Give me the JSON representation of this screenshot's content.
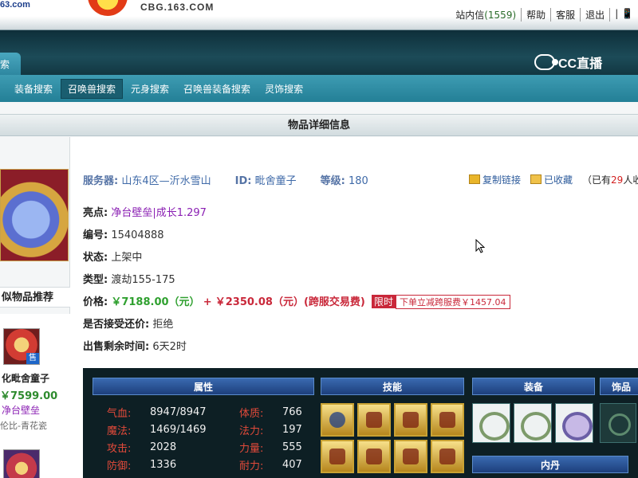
{
  "topbar": {
    "logo_text": "63.com",
    "site_url": "CBG.163.COM",
    "inbox_label": "站内信",
    "inbox_count": "(1559)",
    "help": "帮助",
    "service": "客服",
    "logout": "退出",
    "mobile": "| 📱"
  },
  "navband": {
    "cc_logo": "CC直播",
    "tab_search": "索"
  },
  "subnav": {
    "items": [
      "装备搜索",
      "召唤兽搜索",
      "元身搜索",
      "召唤兽装备搜索",
      "灵饰搜索"
    ],
    "active_index": 1
  },
  "detail_title": "物品详细信息",
  "item": {
    "server_label": "服务器:",
    "server": "山东4区—沂水雪山",
    "id_label": "ID:",
    "id": "毗舍童子",
    "level_label": "等级:",
    "level": "180",
    "copy_link": "复制链接",
    "favorited": "已收藏",
    "fav_count_prefix": "（已有",
    "fav_count": "29",
    "fav_count_suffix": "人收",
    "highlight_label": "亮点:",
    "highlight_value": "净台壁垒|成长1.297",
    "number_label": "编号:",
    "number": "15404888",
    "status_label": "状态:",
    "status": "上架中",
    "type_label": "类型:",
    "type": "渡劫155-175",
    "price_label": "价格:",
    "price_main": "￥7188.00（元）",
    "price_plus": "+",
    "price_fee": "￥2350.08（元）(跨服交易费)",
    "limit_badge": "限时",
    "limit_note": "下单立减跨服费￥1457.04",
    "bargain_label": "是否接受还价:",
    "bargain": "拒绝",
    "remaining_label": "出售剩余时间:",
    "remaining": "6天2时"
  },
  "similar": {
    "heading": "似物品推荐",
    "sold_badge": "售",
    "name": "化毗舍童子",
    "price": "￥7599.00",
    "tag": "净台壁垒",
    "server": "伦比-青花瓷"
  },
  "panel": {
    "attr_header": "属性",
    "skill_header": "技能",
    "equip_header": "装备",
    "accessory_header": "饰品",
    "neidan_header": "内丹",
    "attributes": [
      {
        "k1": "气血:",
        "v1": "8947/8947",
        "k2": "体质:",
        "v2": "766"
      },
      {
        "k1": "魔法:",
        "v1": "1469/1469",
        "k2": "法力:",
        "v2": "197"
      },
      {
        "k1": "攻击:",
        "v1": "2028",
        "k2": "力量:",
        "v2": "555"
      },
      {
        "k1": "防御:",
        "v1": "1336",
        "k2": "耐力:",
        "v2": "407"
      }
    ],
    "skill_icons": [
      "skill-icon-1",
      "skill-icon-2",
      "skill-icon-3",
      "skill-icon-4",
      "skill-icon-5",
      "skill-icon-6",
      "skill-icon-7",
      "skill-icon-8"
    ],
    "equip_icons": [
      "equip-ring-icon",
      "equip-wreath-icon",
      "equip-armor-icon"
    ]
  },
  "colors": {
    "nav_dark": "#123742",
    "subnav": "#2e87a0",
    "price_green": "#2fa02f",
    "price_red": "#c9283a",
    "highlight_purple": "#8a1fb3",
    "panel_bg": "#0d1f24"
  }
}
